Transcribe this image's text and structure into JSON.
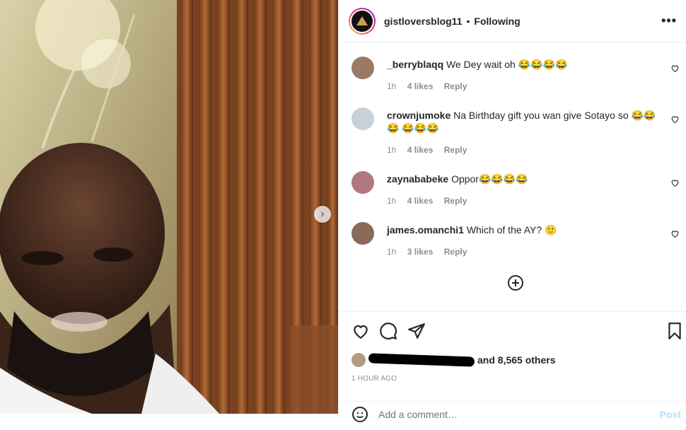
{
  "header": {
    "username": "gistloversblog11",
    "separator": "•",
    "following_label": "Following",
    "more_label": "•••"
  },
  "comments": [
    {
      "user": "_berryblaqq",
      "text": "We Dey wait oh 😂😂😂😂",
      "time": "1h",
      "likes": "4 likes",
      "reply": "Reply"
    },
    {
      "user": "crownjumoke",
      "text": "Na Birthday gift you wan give Sotayo so 😂😂😂 😂😂😂",
      "time": "1h",
      "likes": "4 likes",
      "reply": "Reply"
    },
    {
      "user": "zaynababeke",
      "text": "Oppor😂😂😂😂",
      "time": "1h",
      "likes": "4 likes",
      "reply": "Reply"
    },
    {
      "user": "james.omanchi1",
      "text": "Which of the AY? 🙂",
      "time": "1h",
      "likes": "3 likes",
      "reply": "Reply"
    }
  ],
  "likes": {
    "suffix": "and 8,565 others"
  },
  "post_time": "1 HOUR AGO",
  "add_comment": {
    "placeholder": "Add a comment…",
    "post_label": "Post"
  },
  "icons": {
    "next": "chevron-right-icon",
    "like": "heart-icon",
    "comment": "comment-icon",
    "share": "paper-plane-icon",
    "save": "bookmark-icon",
    "load_more": "plus-circle-icon",
    "emoji": "smiley-icon"
  },
  "colors": {
    "text": "#262626",
    "muted": "#8e8e8e",
    "border": "#efefef",
    "post_disabled": "#b2dffc"
  }
}
